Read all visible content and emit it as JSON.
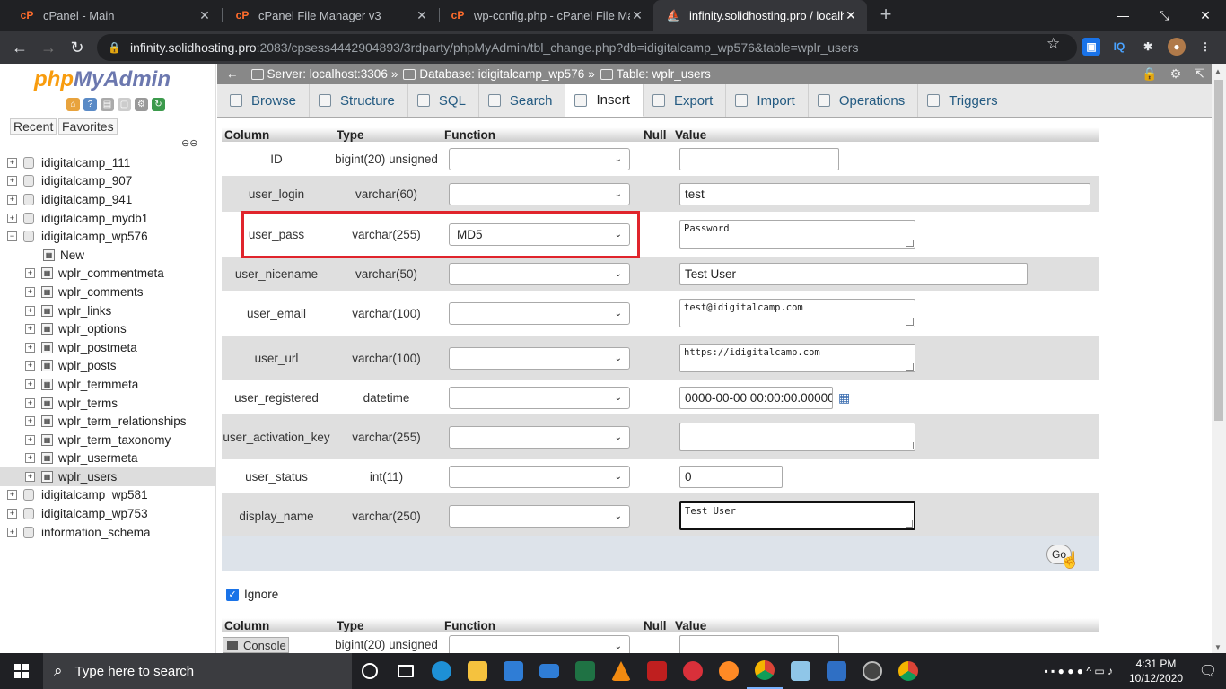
{
  "browser": {
    "tabs": [
      {
        "title": "cPanel - Main"
      },
      {
        "title": "cPanel File Manager v3"
      },
      {
        "title": "wp-config.php - cPanel File Man"
      },
      {
        "title": "infinity.solidhosting.pro / localho"
      }
    ],
    "url_host": "infinity.solidhosting.pro",
    "url_rest": ":2083/cpsess4442904893/3rdparty/phpMyAdmin/tbl_change.php?db=idigitalcamp_wp576&table=wplr_users"
  },
  "sidebar": {
    "logo_php": "php",
    "logo_myadmin": "MyAdmin",
    "recent": "Recent",
    "favorites": "Favorites",
    "tree": [
      {
        "label": "idigitalcamp_111",
        "type": "db",
        "pm": "+"
      },
      {
        "label": "idigitalcamp_907",
        "type": "db",
        "pm": "+"
      },
      {
        "label": "idigitalcamp_941",
        "type": "db",
        "pm": "+"
      },
      {
        "label": "idigitalcamp_mydb1",
        "type": "db",
        "pm": "+"
      },
      {
        "label": "idigitalcamp_wp576",
        "type": "db",
        "pm": "−"
      },
      {
        "label": "New",
        "type": "new"
      },
      {
        "label": "wplr_commentmeta",
        "type": "table"
      },
      {
        "label": "wplr_comments",
        "type": "table"
      },
      {
        "label": "wplr_links",
        "type": "table"
      },
      {
        "label": "wplr_options",
        "type": "table"
      },
      {
        "label": "wplr_postmeta",
        "type": "table"
      },
      {
        "label": "wplr_posts",
        "type": "table"
      },
      {
        "label": "wplr_termmeta",
        "type": "table"
      },
      {
        "label": "wplr_terms",
        "type": "table"
      },
      {
        "label": "wplr_term_relationships",
        "type": "table"
      },
      {
        "label": "wplr_term_taxonomy",
        "type": "table"
      },
      {
        "label": "wplr_usermeta",
        "type": "table"
      },
      {
        "label": "wplr_users",
        "type": "table",
        "selected": true
      },
      {
        "label": "idigitalcamp_wp581",
        "type": "db",
        "pm": "+"
      },
      {
        "label": "idigitalcamp_wp753",
        "type": "db",
        "pm": "+"
      },
      {
        "label": "information_schema",
        "type": "db",
        "pm": "+"
      }
    ]
  },
  "breadcrumb": {
    "server": "Server: localhost:3306",
    "database": "Database: idigitalcamp_wp576",
    "table": "Table: wplr_users"
  },
  "tabs": [
    {
      "label": "Browse"
    },
    {
      "label": "Structure"
    },
    {
      "label": "SQL"
    },
    {
      "label": "Search"
    },
    {
      "label": "Insert",
      "active": true
    },
    {
      "label": "Export"
    },
    {
      "label": "Import"
    },
    {
      "label": "Operations"
    },
    {
      "label": "Triggers"
    }
  ],
  "form": {
    "headers": {
      "column": "Column",
      "type": "Type",
      "function": "Function",
      "null": "Null",
      "value": "Value"
    },
    "rows": [
      {
        "column": "ID",
        "type": "bigint(20) unsigned",
        "function": "",
        "value": "",
        "kind": "input"
      },
      {
        "column": "user_login",
        "type": "varchar(60)",
        "function": "",
        "value": "test",
        "kind": "input"
      },
      {
        "column": "user_pass",
        "type": "varchar(255)",
        "function": "MD5",
        "value": "Password",
        "kind": "textarea"
      },
      {
        "column": "user_nicename",
        "type": "varchar(50)",
        "function": "",
        "value": "Test User",
        "kind": "input"
      },
      {
        "column": "user_email",
        "type": "varchar(100)",
        "function": "",
        "value": "test@idigitalcamp.com",
        "kind": "textarea"
      },
      {
        "column": "user_url",
        "type": "varchar(100)",
        "function": "",
        "value": "https://idigitalcamp.com",
        "kind": "textarea"
      },
      {
        "column": "user_registered",
        "type": "datetime",
        "function": "",
        "value": "0000-00-00 00:00:00.00000",
        "kind": "date"
      },
      {
        "column": "user_activation_key",
        "type": "varchar(255)",
        "function": "",
        "value": "",
        "kind": "textarea"
      },
      {
        "column": "user_status",
        "type": "int(11)",
        "function": "",
        "value": "0",
        "kind": "input"
      },
      {
        "column": "display_name",
        "type": "varchar(250)",
        "function": "",
        "value": "Test User",
        "kind": "textarea",
        "focused": true
      }
    ],
    "go_label": "Go",
    "ignore_label": "Ignore",
    "second_row_type": "bigint(20) unsigned"
  },
  "console_label": "Console",
  "taskbar": {
    "search_placeholder": "Type here to search",
    "time": "4:31 PM",
    "date": "10/12/2020"
  }
}
